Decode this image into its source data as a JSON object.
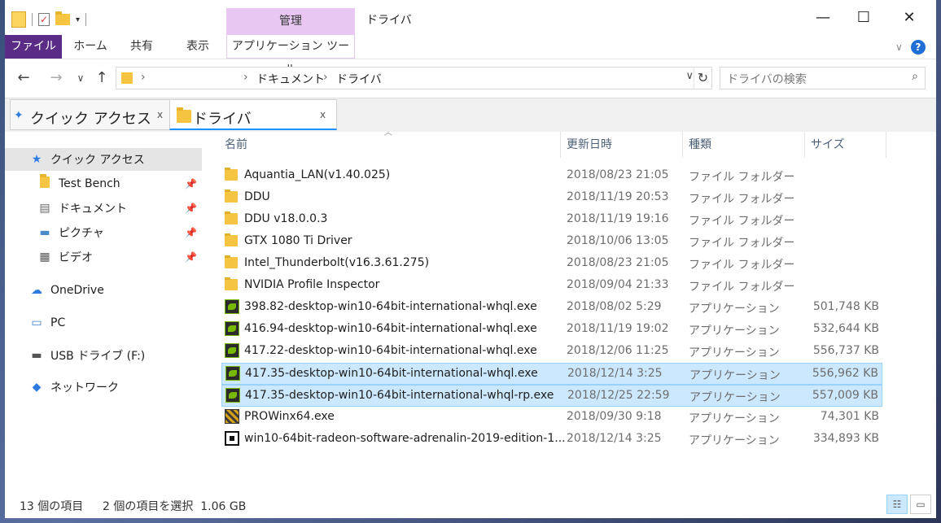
{
  "window": {
    "title": "ドライバ",
    "manage_label": "管理",
    "minimize": "—",
    "maximize": "☐",
    "close": "✕"
  },
  "ribbon": {
    "tabs": [
      "ファイル",
      "ホーム",
      "共有",
      "表示"
    ],
    "tool_tab": "アプリケーション ツール",
    "expand": "∨",
    "help": "?"
  },
  "nav": {
    "back": "←",
    "forward": "→",
    "recent": "∨",
    "up": "↑"
  },
  "address": {
    "root_chevron": "›",
    "breadcrumb": [
      "ドキュメント",
      "ドライバ"
    ],
    "drop": "∨",
    "refresh": "↻"
  },
  "search": {
    "placeholder": "ドライバの検索",
    "icon": "⌕"
  },
  "tabs": [
    {
      "label": "クイック アクセス",
      "icon": "pin-icon",
      "close": "x"
    },
    {
      "label": "ドライバ",
      "icon": "folder-icon",
      "close": "x"
    }
  ],
  "sidebar": {
    "quick_access": "クイック アクセス",
    "pinned": [
      {
        "label": "Test Bench",
        "icon": "folder-icon"
      },
      {
        "label": "ドキュメント",
        "icon": "document-icon"
      },
      {
        "label": "ピクチャ",
        "icon": "pictures-icon"
      },
      {
        "label": "ビデオ",
        "icon": "video-icon"
      }
    ],
    "onedrive": "OneDrive",
    "pc": "PC",
    "usb": "USB ドライブ (F:)",
    "network": "ネットワーク"
  },
  "columns": {
    "name": "名前",
    "date": "更新日時",
    "type": "種類",
    "size": "サイズ"
  },
  "files": [
    {
      "name": "Aquantia_LAN(v1.40.025)",
      "date": "2018/08/23 21:05",
      "type": "ファイル フォルダー",
      "size": "",
      "icon": "folder-icon",
      "selected": false
    },
    {
      "name": "DDU",
      "date": "2018/11/19 20:53",
      "type": "ファイル フォルダー",
      "size": "",
      "icon": "folder-icon",
      "selected": false
    },
    {
      "name": "DDU v18.0.0.3",
      "date": "2018/11/19 19:16",
      "type": "ファイル フォルダー",
      "size": "",
      "icon": "folder-icon",
      "selected": false
    },
    {
      "name": "GTX 1080 Ti Driver",
      "date": "2018/10/06 13:05",
      "type": "ファイル フォルダー",
      "size": "",
      "icon": "folder-icon",
      "selected": false
    },
    {
      "name": "Intel_Thunderbolt(v16.3.61.275)",
      "date": "2018/08/23 21:05",
      "type": "ファイル フォルダー",
      "size": "",
      "icon": "folder-icon",
      "selected": false
    },
    {
      "name": "NVIDIA Profile Inspector",
      "date": "2018/09/04 21:33",
      "type": "ファイル フォルダー",
      "size": "",
      "icon": "folder-icon",
      "selected": false
    },
    {
      "name": "398.82-desktop-win10-64bit-international-whql.exe",
      "date": "2018/08/02 5:29",
      "type": "アプリケーション",
      "size": "501,748 KB",
      "icon": "nvidia-icon",
      "selected": false
    },
    {
      "name": "416.94-desktop-win10-64bit-international-whql.exe",
      "date": "2018/11/19 19:02",
      "type": "アプリケーション",
      "size": "532,644 KB",
      "icon": "nvidia-icon",
      "selected": false
    },
    {
      "name": "417.22-desktop-win10-64bit-international-whql.exe",
      "date": "2018/12/06 11:25",
      "type": "アプリケーション",
      "size": "556,737 KB",
      "icon": "nvidia-icon",
      "selected": false
    },
    {
      "name": "417.35-desktop-win10-64bit-international-whql.exe",
      "date": "2018/12/14 3:25",
      "type": "アプリケーション",
      "size": "556,962 KB",
      "icon": "nvidia-icon",
      "selected": true
    },
    {
      "name": "417.35-desktop-win10-64bit-international-whql-rp.exe",
      "date": "2018/12/25 22:59",
      "type": "アプリケーション",
      "size": "557,009 KB",
      "icon": "nvidia-icon",
      "selected": true
    },
    {
      "name": "PROWinx64.exe",
      "date": "2018/09/30 9:18",
      "type": "アプリケーション",
      "size": "74,301 KB",
      "icon": "installer-icon",
      "selected": false
    },
    {
      "name": "win10-64bit-radeon-software-adrenalin-2019-edition-1...",
      "date": "2018/12/14 3:25",
      "type": "アプリケーション",
      "size": "334,893 KB",
      "icon": "amd-icon",
      "selected": false
    }
  ],
  "status": {
    "count": "13 個の項目",
    "selection": "2 個の項目を選択  1.06 GB"
  },
  "views": {
    "details": "☷",
    "tiles": "▭"
  }
}
